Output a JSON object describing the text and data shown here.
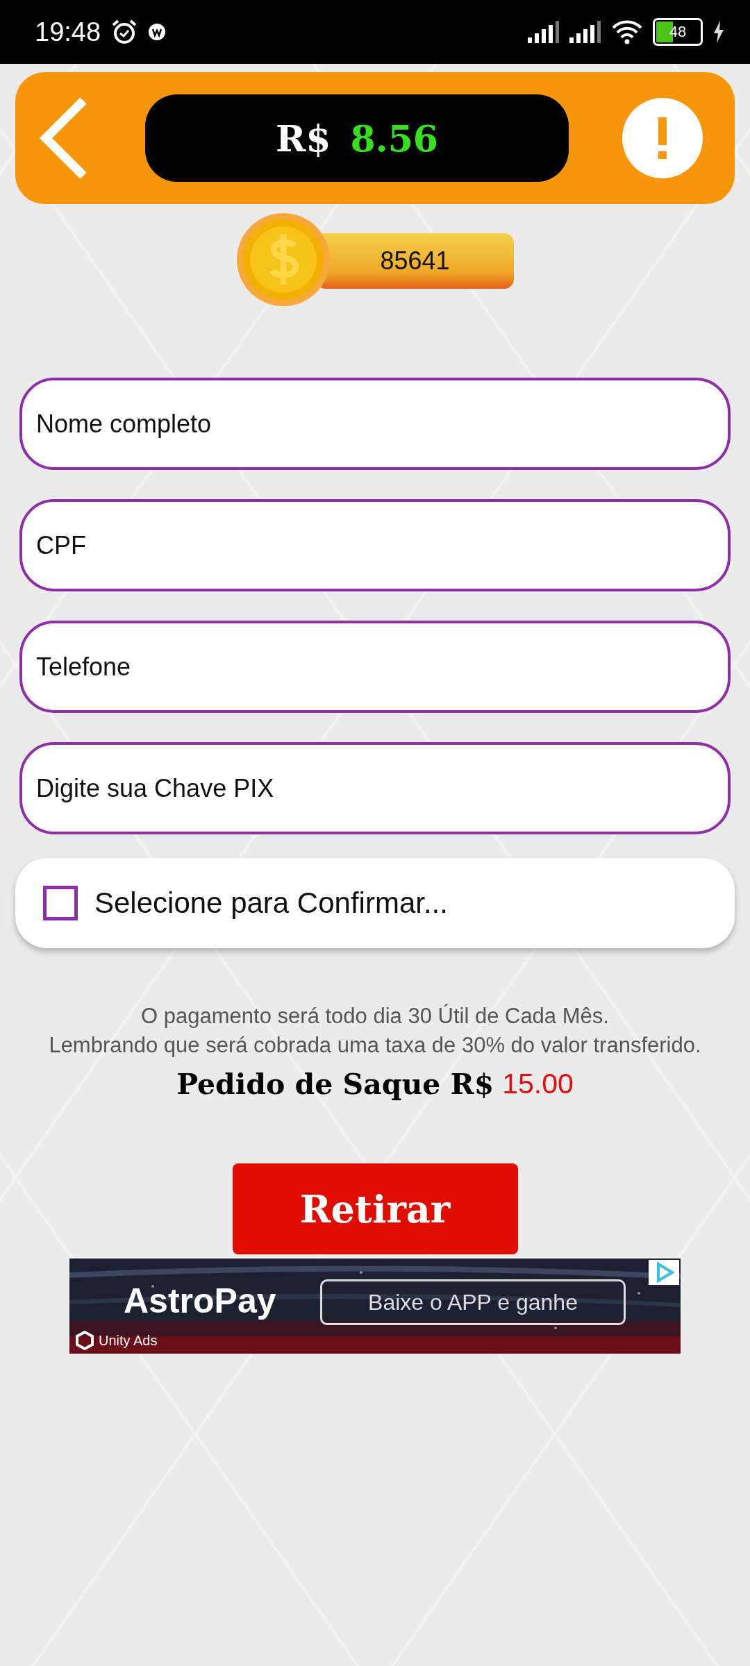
{
  "status_bar": {
    "time": "19:48",
    "battery": "48"
  },
  "header": {
    "currency": "R$",
    "balance": "8.56"
  },
  "coins": {
    "count": "85641"
  },
  "fields": [
    {
      "placeholder": "Nome completo"
    },
    {
      "placeholder": "CPF"
    },
    {
      "placeholder": "Telefone"
    },
    {
      "placeholder": "Digite sua Chave PIX"
    }
  ],
  "confirm": {
    "label": "Selecione para Confirmar...",
    "checked": false
  },
  "notice": [
    "O pagamento será todo dia 30 Útil de Cada Mês.",
    "Lembrando que será cobrada uma taxa de 30% do valor transferido."
  ],
  "withdraw_total": {
    "label": "Pedido de Saque R$",
    "amount": "15.00"
  },
  "withdraw_button": "Retirar",
  "ad": {
    "brand": "AstroPay",
    "cta": "Baixe o APP e ganhe",
    "network": "Unity Ads"
  }
}
